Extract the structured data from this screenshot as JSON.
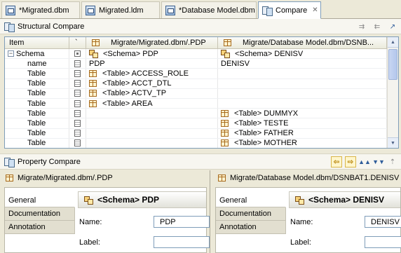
{
  "tabs": [
    {
      "label": "*Migrated.dbm",
      "icon": "dbm-file-icon",
      "active": false
    },
    {
      "label": "Migrated.ldm",
      "icon": "ldm-file-icon",
      "active": false
    },
    {
      "label": "*Database Model.dbm",
      "icon": "dbm-file-icon",
      "active": false
    },
    {
      "label": "Compare",
      "icon": "compare-icon",
      "active": true,
      "close": "✕"
    }
  ],
  "structural": {
    "title": "Structural Compare",
    "columns": {
      "item": "Item",
      "marker": "`",
      "left": "Migrate/Migrated.dbm/.PDP",
      "right": "Migrate/Database Model.dbm/DSNB..."
    },
    "rows": [
      {
        "item": "Schema",
        "expander": "−",
        "left": "<Schema> PDP",
        "right": "<Schema> DENISV",
        "left_icon": "schema",
        "right_icon": "schema",
        "marker": "box"
      },
      {
        "item": "name",
        "left": "PDP",
        "right": "DENISV",
        "marker": "doc"
      },
      {
        "item": "Table",
        "left": "<Table> ACCESS_ROLE",
        "right": "",
        "left_icon": "table",
        "marker": "doc"
      },
      {
        "item": "Table",
        "left": "<Table> ACCT_DTL",
        "right": "",
        "left_icon": "table",
        "marker": "doc"
      },
      {
        "item": "Table",
        "left": "<Table> ACTV_TP",
        "right": "",
        "left_icon": "table",
        "marker": "doc"
      },
      {
        "item": "Table",
        "left": "<Table> AREA",
        "right": "",
        "left_icon": "table",
        "marker": "doc"
      },
      {
        "item": "Table",
        "left": "",
        "right": "<Table> DUMMYX",
        "right_icon": "table",
        "marker": "doc"
      },
      {
        "item": "Table",
        "left": "",
        "right": "<Table> TESTE",
        "right_icon": "table",
        "marker": "doc"
      },
      {
        "item": "Table",
        "left": "",
        "right": "<Table> FATHER",
        "right_icon": "table",
        "marker": "doc"
      },
      {
        "item": "Table",
        "left": "",
        "right": "<Table> MOTHER",
        "right_icon": "table",
        "marker": "doc"
      }
    ]
  },
  "property": {
    "title": "Property Compare",
    "left": {
      "path": "Migrate/Migrated.dbm/.PDP",
      "tabs": [
        "General",
        "Documentation",
        "Annotation"
      ],
      "selected_tab": "General",
      "object_title": "<Schema> PDP",
      "name_label": "Name:",
      "name_value": "PDP",
      "label_label": "Label:",
      "label_value": ""
    },
    "right": {
      "path": "Migrate/Database Model.dbm/DSNBAT1.DENISV",
      "tabs": [
        "General",
        "Documentation",
        "Annotation"
      ],
      "selected_tab": "General",
      "object_title": "<Schema> DENISV",
      "name_label": "Name:",
      "name_value": "DENISV",
      "label_label": "Label:",
      "label_value": ""
    }
  },
  "colors": {
    "chrome": "#ece9d8",
    "border": "#7f9db9",
    "table_icon": "#a66a1c"
  }
}
